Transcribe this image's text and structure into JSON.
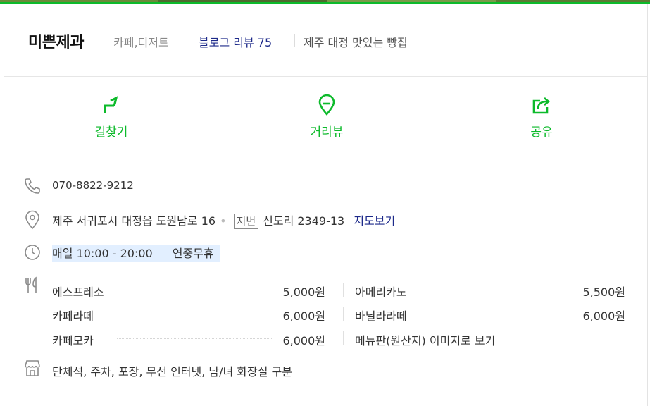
{
  "place": {
    "name": "미쁜제과",
    "category": "카페,디저트",
    "blog_review_label": "블로그 리뷰 75",
    "slogan": "제주 대정 맛있는 빵집"
  },
  "actions": {
    "directions_label": "길찾기",
    "streetview_label": "거리뷰",
    "share_label": "공유"
  },
  "info": {
    "phone": "070-8822-9212",
    "address": "제주 서귀포시 대정읍 도원남로 16",
    "jibun_tag": "지번",
    "jibun_address": "신도리 2349-13",
    "map_link": "지도보기",
    "hours": "매일 10:00 - 20:00",
    "holiday": "연중무휴",
    "amenities": "단체석, 주차, 포장, 무선 인터넷, 남/녀 화장실 구분"
  },
  "menu": {
    "items": [
      {
        "name": "에스프레소",
        "price": "5,000원"
      },
      {
        "name": "아메리카노",
        "price": "5,500원"
      },
      {
        "name": "카페라떼",
        "price": "6,000원"
      },
      {
        "name": "바닐라라떼",
        "price": "6,000원"
      },
      {
        "name": "카페모카",
        "price": "6,000원"
      }
    ],
    "menu_board_link": "메뉴판(원산지) 이미지로 보기"
  },
  "colors": {
    "accent_green": "#0dba2b",
    "link_navy": "#1d2a8a",
    "hours_highlight": "#e2efff"
  }
}
